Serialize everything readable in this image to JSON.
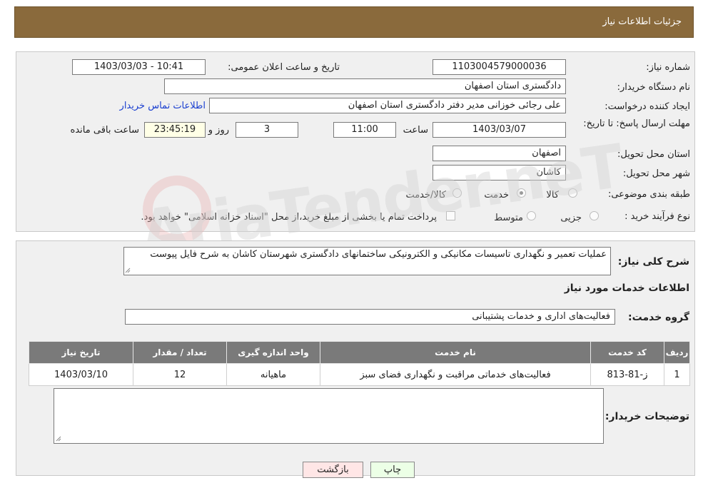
{
  "header": {
    "title": "جزئیات اطلاعات نیاز"
  },
  "details": {
    "need_number_label": "شماره نیاز:",
    "need_number": "1103004579000036",
    "announce_label": "تاریخ و ساعت اعلان عمومی:",
    "announce_value": "1403/03/03 - 10:41",
    "buyer_org_label": "نام دستگاه خریدار:",
    "buyer_org": "دادگستری استان اصفهان",
    "creator_label": "ایجاد کننده درخواست:",
    "creator": "علی رجائی خوزانی مدیر دفتر دادگستری استان اصفهان",
    "contact_link": "اطلاعات تماس خریدار",
    "deadline_label": "مهلت ارسال پاسخ: تا تاریخ:",
    "deadline_date": "1403/03/07",
    "time_label": "ساعت",
    "deadline_time": "11:00",
    "days": "3",
    "days_label": "روز و",
    "remaining_time": "23:45:19",
    "remaining_label": "ساعت باقی مانده",
    "province_label": "استان محل تحویل:",
    "province": "اصفهان",
    "city_label": "شهر محل تحویل:",
    "city": "کاشان",
    "category_label": "طبقه بندی موضوعی:",
    "category_options": [
      "کالا",
      "خدمت",
      "کالا/خدمت"
    ],
    "purchase_type_label": "نوع فرآیند خرید :",
    "purchase_options": [
      "جزیی",
      "متوسط"
    ],
    "payment_note": "پرداخت تمام یا بخشی از مبلغ خرید،از محل \"اسناد خزانه اسلامی\" خواهد بود."
  },
  "description": {
    "label": "شرح کلی نیاز:",
    "text": "عملیات تعمیر و نگهداری تاسیسات مکانیکی و الکترونیکی ساختمانهای دادگستری شهرستان کاشان به شرح فایل پیوست"
  },
  "services": {
    "section_title": "اطلاعات خدمات مورد نیاز",
    "group_label": "گروه خدمت:",
    "group_value": "فعالیت‌های اداری و خدمات پشتیبانی",
    "columns": [
      "ردیف",
      "کد خدمت",
      "نام خدمت",
      "واحد اندازه گیری",
      "تعداد / مقدار",
      "تاریخ نیاز"
    ],
    "rows": [
      [
        "1",
        "ز-81-813",
        "فعالیت‌های خدماتی مراقبت و نگهداری فضای سبز",
        "ماهیانه",
        "12",
        "1403/03/10"
      ]
    ]
  },
  "buyer_notes": {
    "label": "توضیحات خریدار:",
    "text": ""
  },
  "buttons": {
    "print": "چاپ",
    "back": "بازگشت"
  },
  "watermark": {
    "text": "AriaTender.neT"
  },
  "colors": {
    "header_bg": "#8a6a3c",
    "print_btn": "#ecffe6",
    "back_btn": "#ffe6e6",
    "table_header": "#7a7a7a",
    "link": "#1a3fd0"
  }
}
